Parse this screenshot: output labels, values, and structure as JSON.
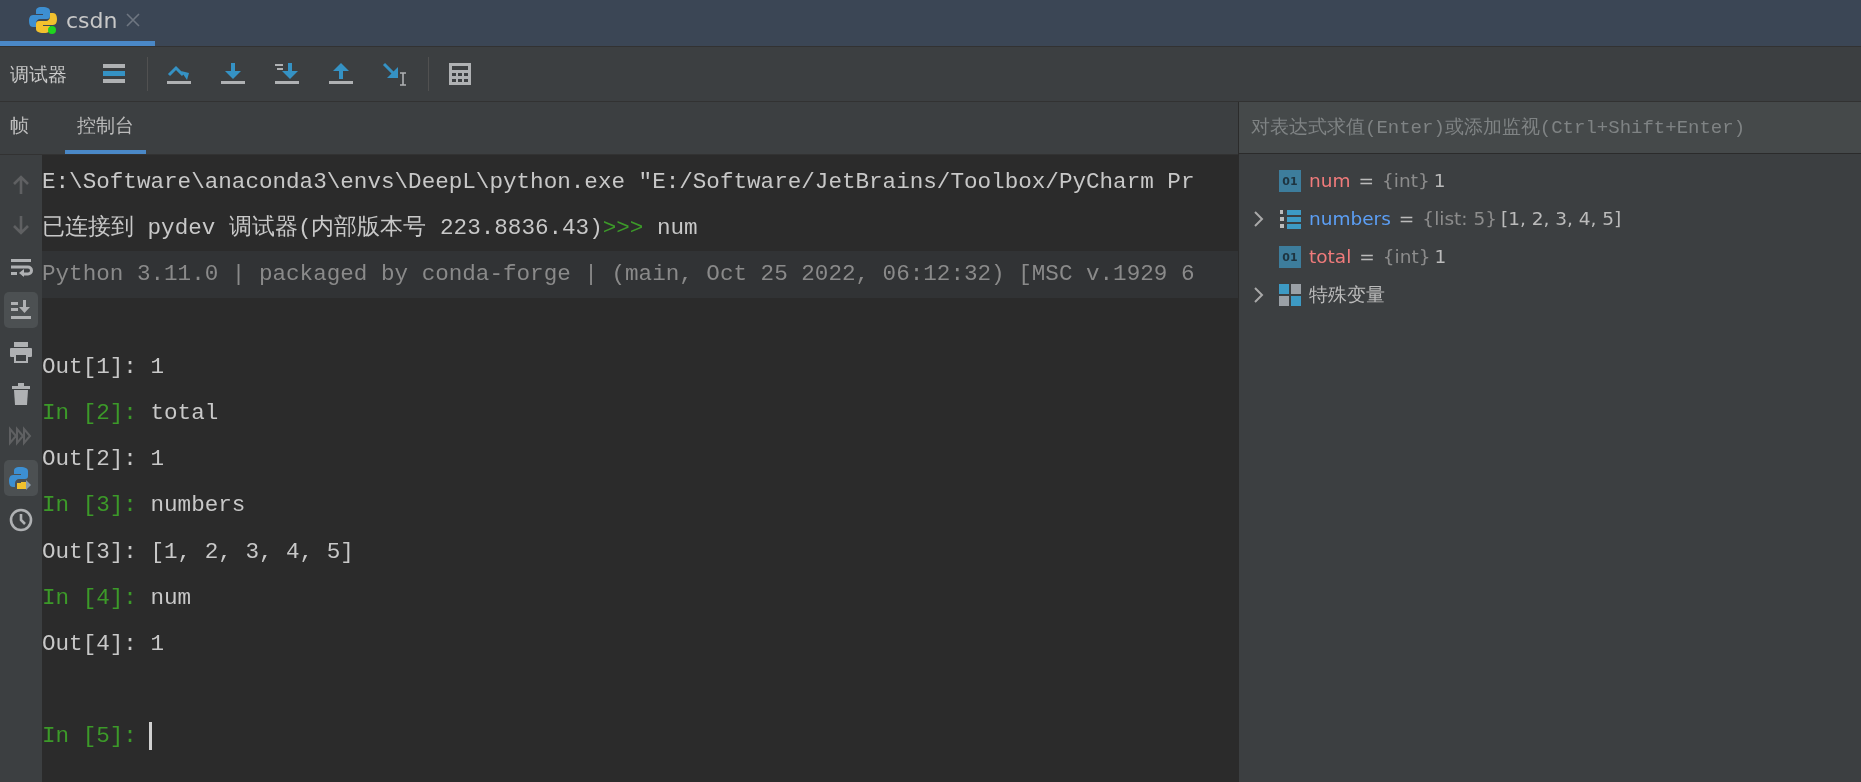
{
  "editor_tab": {
    "label": "csdn",
    "selected": true
  },
  "toolbar": {
    "label": "调试器"
  },
  "panel_tabs": [
    {
      "label": "帧",
      "selected": false
    },
    {
      "label": "控制台",
      "selected": true
    }
  ],
  "gutter": [
    {
      "kind": "up",
      "selected": false,
      "disabled": true
    },
    {
      "kind": "down",
      "selected": false,
      "disabled": true
    },
    {
      "kind": "wrap",
      "selected": false,
      "disabled": false
    },
    {
      "kind": "scroll",
      "selected": true,
      "disabled": false
    },
    {
      "kind": "print",
      "selected": false,
      "disabled": false
    },
    {
      "kind": "trash",
      "selected": false,
      "disabled": false
    },
    {
      "kind": "forward",
      "selected": false,
      "disabled": true
    },
    {
      "kind": "python",
      "selected": true,
      "disabled": false
    },
    {
      "kind": "clock",
      "selected": false,
      "disabled": false
    }
  ],
  "console": {
    "lines": [
      {
        "kind": "plain",
        "parts": [
          {
            "kind": "text",
            "text": "E:\\Software\\anaconda3\\envs\\DeepL\\python.exe \"E:/Software/JetBrains/Toolbox/PyCharm Pr"
          }
        ]
      },
      {
        "kind": "plain",
        "parts": [
          {
            "kind": "text",
            "text": "已连接到 pydev 调试器(内部版本号 223.8836.43)"
          },
          {
            "kind": "prompt",
            "text": ">>>"
          },
          {
            "kind": "text",
            "text": " num"
          }
        ]
      },
      {
        "kind": "banner",
        "parts": [
          {
            "kind": "text",
            "text": "Python 3.11.0 | packaged by conda-forge | (main, Oct 25 2022, 06:12:32) [MSC v.1929 6"
          }
        ]
      },
      {
        "kind": "blank"
      },
      {
        "kind": "plain",
        "parts": [
          {
            "kind": "text",
            "text": "Out[1]: 1"
          }
        ]
      },
      {
        "kind": "plain",
        "parts": [
          {
            "kind": "prompt",
            "text": "In [2]:"
          },
          {
            "kind": "text",
            "text": " total"
          }
        ]
      },
      {
        "kind": "plain",
        "parts": [
          {
            "kind": "text",
            "text": "Out[2]: 1"
          }
        ]
      },
      {
        "kind": "plain",
        "parts": [
          {
            "kind": "prompt",
            "text": "In [3]:"
          },
          {
            "kind": "text",
            "text": " numbers"
          }
        ]
      },
      {
        "kind": "plain",
        "parts": [
          {
            "kind": "text",
            "text": "Out[3]: [1, 2, 3, 4, 5]"
          }
        ]
      },
      {
        "kind": "plain",
        "parts": [
          {
            "kind": "prompt",
            "text": "In [4]:"
          },
          {
            "kind": "text",
            "text": " num"
          }
        ]
      },
      {
        "kind": "plain",
        "parts": [
          {
            "kind": "text",
            "text": "Out[4]: 1"
          }
        ]
      },
      {
        "kind": "blank"
      },
      {
        "kind": "current",
        "parts": [
          {
            "kind": "prompt",
            "text": "In [5]:"
          }
        ]
      }
    ]
  },
  "variables": {
    "placeholder": "对表达式求值(Enter)或添加监视(Ctrl+Shift+Enter)",
    "items": [
      {
        "kind": "scalar",
        "badge": "01",
        "expandable": false,
        "name": "num",
        "color": "#f07b7b",
        "separator": "=",
        "type": "{int}",
        "value": "1"
      },
      {
        "kind": "list",
        "expandable": true,
        "name": "numbers",
        "color": "#5c9ff5",
        "separator": "=",
        "type": "{list: 5}",
        "value": "[1, 2, 3, 4, 5]"
      },
      {
        "kind": "scalar",
        "badge": "01",
        "expandable": false,
        "name": "total",
        "color": "#f07b7b",
        "separator": "=",
        "type": "{int}",
        "value": "1"
      },
      {
        "kind": "group",
        "expandable": true,
        "name": "特殊变量",
        "color": "#bbbbbb"
      }
    ]
  }
}
